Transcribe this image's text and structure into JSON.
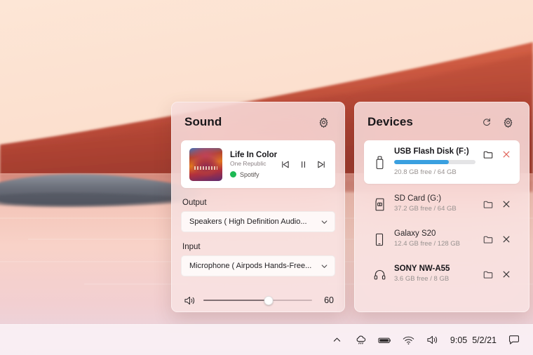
{
  "wallpaper": {
    "description": "sunset-lake-landscape",
    "sky_color": "#fbe0d1",
    "hill_color": "#cb5440",
    "hill_dark_color": "#a8402f",
    "water_color": "#f6cec4",
    "island_color": "#6e717b"
  },
  "sound_panel": {
    "title": "Sound",
    "settings_icon": "gear-icon",
    "media": {
      "track_title": "Life In Color",
      "artist": "One Republic",
      "source": "Spotify",
      "source_color": "#1db954",
      "controls": {
        "previous": "previous-track-icon",
        "play_pause": "pause-icon",
        "next": "next-track-icon"
      }
    },
    "output": {
      "label": "Output",
      "value": "Speakers ( High Definition Audio...",
      "chevron": "chevron-down-icon"
    },
    "input": {
      "label": "Input",
      "value": "Microphone ( Airpods Hands-Free...",
      "chevron": "chevron-down-icon"
    },
    "volume": {
      "icon": "speaker-icon",
      "value": "60",
      "percent": 60,
      "min": 0,
      "max": 100
    }
  },
  "devices_panel": {
    "title": "Devices",
    "refresh_icon": "refresh-icon",
    "settings_icon": "gear-icon",
    "items": [
      {
        "name": "USB Flash Disk (F:)",
        "icon": "usb-drive-icon",
        "used_percent": 67,
        "bar_color": "#3aa0e0",
        "free": "20.8 GB free",
        "separator": "/",
        "total": "64 GB",
        "open_icon": "folder-icon",
        "eject_icon": "close-icon",
        "eject_color": "#e2695f",
        "selected": true
      },
      {
        "name": "SD Card (G:)",
        "icon": "sd-card-icon",
        "free": "37.2 GB free",
        "separator": "/",
        "total": "64 GB",
        "open_icon": "folder-icon",
        "eject_icon": "close-icon",
        "eject_color": "#3d3a3b",
        "selected": false
      },
      {
        "name": "Galaxy S20",
        "icon": "phone-icon",
        "free": "12.4 GB free",
        "separator": "/",
        "total": "128 GB",
        "open_icon": "folder-icon",
        "eject_icon": "close-icon",
        "eject_color": "#3d3a3b",
        "selected": false
      },
      {
        "name": "SONY NW-A55",
        "icon": "headphones-icon",
        "free": "3.6 GB free",
        "separator": "/",
        "total": "8 GB",
        "open_icon": "folder-icon",
        "eject_icon": "close-icon",
        "eject_color": "#3d3a3b",
        "selected": false
      }
    ]
  },
  "taskbar": {
    "show_hidden_icons": "chevron-up-icon",
    "onedrive": "cloud-icon",
    "battery": "battery-icon",
    "network": "wifi-icon",
    "volume": "speaker-icon",
    "time": "9:05",
    "date": "5/2/21",
    "notifications": "chat-bubble-icon"
  }
}
